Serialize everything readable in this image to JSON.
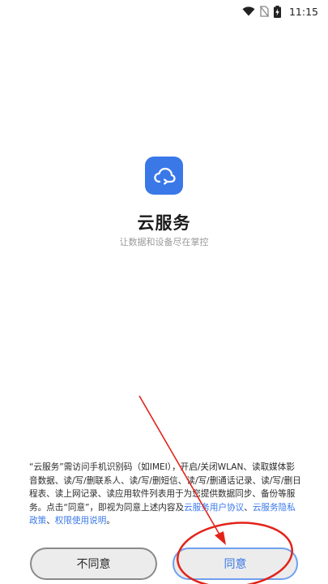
{
  "status_bar": {
    "time": "11:15",
    "icons": [
      "wifi-icon",
      "no-sim-icon",
      "battery-charging-icon"
    ]
  },
  "app": {
    "icon": "cloud-sync-icon",
    "title": "云服务",
    "subtitle": "让数据和设备尽在掌控"
  },
  "notice": {
    "text": "“云服务”需访问手机识别码（如IMEI），开启/关闭WLAN、读取媒体影音数据、读/写/删联系人、读/写/删短信、读/写/删通话记录、读/写/删日程表、读上网记录、读应用软件列表用于为您提供数据同步、备份等服务。点击“同意”，即视为同意上述内容及",
    "link_user_agreement": "云服务用户协议",
    "sep1": "、",
    "link_privacy_policy": "云服务隐私政策",
    "sep2": "、",
    "link_permission_info": "权限使用说明",
    "end": "。"
  },
  "buttons": {
    "disagree_label": "不同意",
    "agree_label": "同意"
  },
  "colors": {
    "accent": "#3a78e8",
    "annotation_red": "#e2231a",
    "button_bg": "#ececec"
  }
}
